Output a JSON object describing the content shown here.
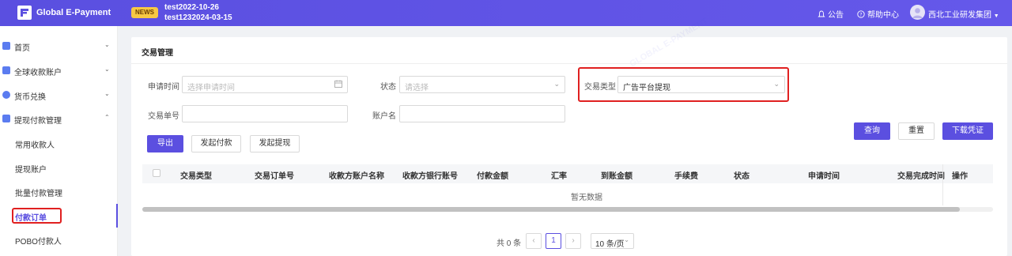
{
  "header": {
    "app_name": "Global E-Payment",
    "news_badge": "NEWS",
    "news_line1": "test2022-10-26",
    "news_line2": "test1232024-03-15",
    "notice": "公告",
    "help": "帮助中心",
    "company": "西北工业研发集团",
    "brand_color": "#5b4fe0"
  },
  "sidebar": {
    "items": [
      {
        "label": "首页",
        "icon": "home-icon",
        "chevron": "⌄"
      },
      {
        "label": "全球收款账户",
        "icon": "wallet-icon",
        "chevron": "⌄"
      },
      {
        "label": "货币兑换",
        "icon": "exchange-icon",
        "chevron": "⌄"
      },
      {
        "label": "提现付款管理",
        "icon": "payout-icon",
        "chevron": "⌃"
      }
    ],
    "sub_items": [
      {
        "label": "常用收款人"
      },
      {
        "label": "提现账户"
      },
      {
        "label": "批量付款管理"
      },
      {
        "label": "付款订单"
      },
      {
        "label": "POBO付款人"
      }
    ]
  },
  "main": {
    "title": "交易管理",
    "filters": {
      "apply_time_label": "申请时间",
      "apply_time_placeholder": "选择申请时间",
      "status_label": "状态",
      "status_placeholder": "请选择",
      "type_label": "交易类型",
      "type_value": "广告平台提现",
      "order_no_label": "交易单号",
      "account_name_label": "账户名"
    },
    "buttons": {
      "query": "查询",
      "reset": "重置",
      "download": "下载凭证",
      "export": "导出",
      "start_payment": "发起付款",
      "start_withdraw": "发起提现"
    },
    "table": {
      "columns": [
        "交易类型",
        "交易订单号",
        "收款方账户名称",
        "收款方银行账号",
        "付款金额",
        "汇率",
        "到账金额",
        "手续费",
        "状态",
        "申请时间",
        "交易完成时间",
        "操作"
      ],
      "empty_text": "暂无数据"
    },
    "pagination": {
      "total": "共 0 条",
      "current_page": "1",
      "page_size": "10 条/页"
    }
  }
}
